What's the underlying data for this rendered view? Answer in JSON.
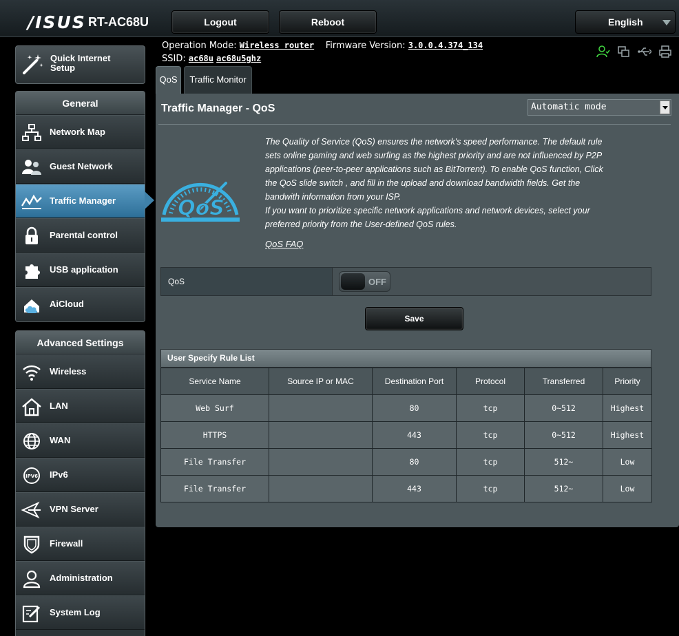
{
  "header": {
    "brand": "/ISUS",
    "model": "RT-AC68U",
    "logout_label": "Logout",
    "reboot_label": "Reboot",
    "language": "English"
  },
  "info": {
    "operation_mode_label": "Operation Mode:",
    "operation_mode_value": "Wireless router",
    "firmware_label": "Firmware Version:",
    "firmware_value": "3.0.0.4.374_134",
    "ssid_label": "SSID:",
    "ssid_values": [
      "ac68u",
      "ac68u5ghz"
    ]
  },
  "status_icons": [
    "user-icon",
    "copy-icon",
    "usb-icon",
    "printer-icon"
  ],
  "sidebar": {
    "qis_label_1": "Quick Internet",
    "qis_label_2": "Setup",
    "general_title": "General",
    "general_items": [
      {
        "label": "Network Map",
        "icon": "network-map-icon"
      },
      {
        "label": "Guest Network",
        "icon": "guest-network-icon"
      },
      {
        "label": "Traffic Manager",
        "icon": "traffic-manager-icon",
        "active": true
      },
      {
        "label": "Parental control",
        "icon": "parental-control-icon"
      },
      {
        "label": "USB application",
        "icon": "usb-application-icon"
      },
      {
        "label": "AiCloud",
        "icon": "aicloud-icon"
      }
    ],
    "advanced_title": "Advanced Settings",
    "advanced_items": [
      {
        "label": "Wireless",
        "icon": "wireless-icon"
      },
      {
        "label": "LAN",
        "icon": "lan-icon"
      },
      {
        "label": "WAN",
        "icon": "wan-icon"
      },
      {
        "label": "IPv6",
        "icon": "ipv6-icon"
      },
      {
        "label": "VPN Server",
        "icon": "vpn-server-icon"
      },
      {
        "label": "Firewall",
        "icon": "firewall-icon"
      },
      {
        "label": "Administration",
        "icon": "administration-icon"
      },
      {
        "label": "System Log",
        "icon": "system-log-icon"
      }
    ]
  },
  "tabs": [
    {
      "label": "QoS",
      "active": true
    },
    {
      "label": "Traffic Monitor",
      "active": false
    }
  ],
  "main": {
    "title": "Traffic Manager - QoS",
    "mode_select": "Automatic mode",
    "description_1": "The Quality of Service (QoS) ensures the network's speed performance. The default rule sets online gaming and web surfing as the highest priority and are not influenced by P2P applications (peer-to-peer applications such as BitTorrent). To enable QoS function, Click the QoS slide switch , and fill in the upload and download bandwidth fields. Get the bandwith information from your ISP.",
    "description_2": "If you want to prioritize specific network applications and network devices, select your preferred priority from the User-defined QoS rules.",
    "faq_label": "QoS FAQ",
    "qos_label": "QoS",
    "qos_state": "OFF",
    "save_label": "Save",
    "logo_text": "QoS"
  },
  "rules": {
    "title": "User Specify Rule List",
    "columns": [
      "Service Name",
      "Source IP or MAC",
      "Destination Port",
      "Protocol",
      "Transferred",
      "Priority"
    ],
    "rows": [
      [
        "Web Surf",
        "",
        "80",
        "tcp",
        "0~512",
        "Highest"
      ],
      [
        "HTTPS",
        "",
        "443",
        "tcp",
        "0~512",
        "Highest"
      ],
      [
        "File Transfer",
        "",
        "80",
        "tcp",
        "512~",
        "Low"
      ],
      [
        "File Transfer",
        "",
        "443",
        "tcp",
        "512~",
        "Low"
      ]
    ]
  },
  "colors": {
    "accent": "#3f81a9",
    "qos_logo": "#3ab0e0",
    "status_green": "#3fd13f"
  }
}
